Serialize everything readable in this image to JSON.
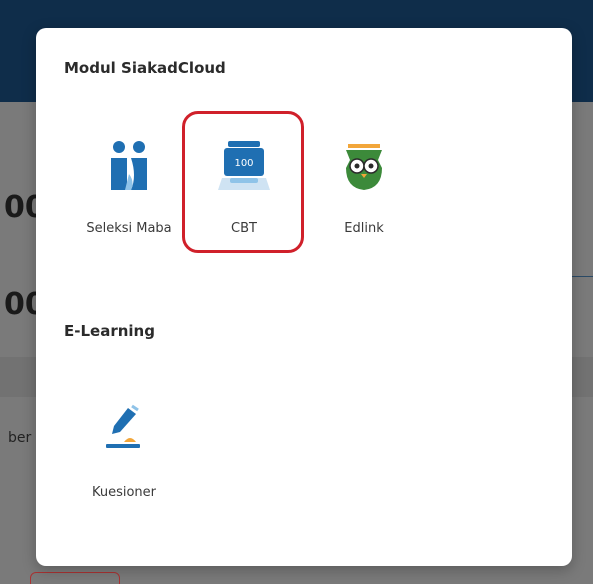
{
  "background": {
    "stat_1": "00",
    "stat_2": "00",
    "row_text": "ber"
  },
  "modal": {
    "sections": [
      {
        "title": "Modul SiakadCloud",
        "items": [
          {
            "label": "Seleksi Maba",
            "icon": "people-icon"
          },
          {
            "label": "CBT",
            "icon": "cbt-monitor-icon",
            "badge": "100"
          },
          {
            "label": "Edlink",
            "icon": "owl-icon"
          }
        ]
      },
      {
        "title": "E-Learning",
        "items": [
          {
            "label": "Kuesioner",
            "icon": "pen-survey-icon"
          }
        ]
      }
    ]
  },
  "colors": {
    "primary_blue": "#1f6fb2",
    "light_blue": "#8fc3e8",
    "owl_green": "#3c8a3a",
    "accent_orange": "#f2a63a",
    "highlight_red": "#d0202a"
  }
}
